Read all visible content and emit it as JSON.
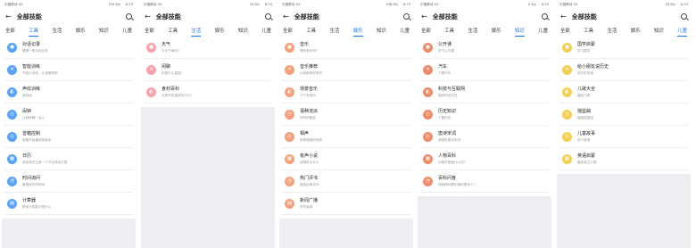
{
  "screens": [
    {
      "status": {
        "carrier": "中国移动 4G",
        "speed": "199 B/s",
        "time": "8:29"
      },
      "title": "全部技能",
      "tabs": [
        "全部",
        "工具",
        "生活",
        "娱乐",
        "知识",
        "儿童"
      ],
      "active_tab": 1,
      "items": [
        {
          "title": "对话记录",
          "subtitle": "看看一条对话记录",
          "color": "#5aa2f5",
          "icon": "chat-icon"
        },
        {
          "title": "智能训练",
          "subtitle": "不如小训练，让我更聪明",
          "color": "#5aa2f5",
          "icon": "tools-icon"
        },
        {
          "title": "声纹训练",
          "subtitle": "我说话",
          "color": "#5aa2f5",
          "icon": "voiceprint-icon"
        },
        {
          "title": "闹钟",
          "subtitle": "让我再睡一会儿",
          "color": "#5aa2f5",
          "icon": "alarm-icon"
        },
        {
          "title": "音箱控制",
          "subtitle": "音箱开始播放新版本",
          "color": "#5aa2f5",
          "icon": "speaker-icon"
        },
        {
          "title": "日历",
          "subtitle": "添加和关注某一个节日或者日程",
          "color": "#5aa2f5",
          "icon": "calendar-icon"
        },
        {
          "title": "时间询问",
          "subtitle": "看看现在的时间",
          "color": "#5aa2f5",
          "icon": "clock-icon"
        },
        {
          "title": "计算器",
          "subtitle": "帮你计算数字是什么",
          "color": "#5aa2f5",
          "icon": "calculator-icon"
        }
      ]
    },
    {
      "status": {
        "carrier": "中国移动 4G",
        "speed": "26 B/s",
        "time": "8:29"
      },
      "title": "全部技能",
      "tabs": [
        "全部",
        "工具",
        "生活",
        "娱乐",
        "知识",
        "儿童"
      ],
      "active_tab": 2,
      "items": [
        {
          "title": "天气",
          "subtitle": "今天下雨吗？",
          "color": "#f7a3ab",
          "icon": "cloud-icon"
        },
        {
          "title": "闲聊",
          "subtitle": "你是什么星座？",
          "color": "#f7a3ab",
          "icon": "chat-bubble-icon"
        },
        {
          "title": "食材百科",
          "subtitle": "总是不知道该吃什么？",
          "color": "#f7a3ab",
          "icon": "food-icon"
        }
      ]
    },
    {
      "status": {
        "carrier": "中国移动 4G",
        "speed": "298 B/s",
        "time": "8:29"
      },
      "title": "全部技能",
      "tabs": [
        "全部",
        "工具",
        "生活",
        "娱乐",
        "知识",
        "儿童"
      ],
      "active_tab": 3,
      "items": [
        {
          "title": "音乐",
          "subtitle": "想听音乐吗？",
          "color": "#f4a07b",
          "icon": "music-icon"
        },
        {
          "title": "音乐推荐",
          "subtitle": "为你推荐好听的",
          "color": "#f4a07b",
          "icon": "music-note-icon"
        },
        {
          "title": "场景音乐",
          "subtitle": "下午茶音乐",
          "color": "#f4a07b",
          "icon": "scene-music-icon"
        },
        {
          "title": "语种流派",
          "subtitle": "好听的歌曲",
          "color": "#f4a07b",
          "icon": "genre-icon"
        },
        {
          "title": "相声",
          "subtitle": "听郭德纲的相声",
          "color": "#f4a07b",
          "icon": "crosstalk-icon"
        },
        {
          "title": "有声小说",
          "subtitle": "我想听点什么",
          "color": "#f4a07b",
          "icon": "audiobook-icon"
        },
        {
          "title": "热门评书",
          "subtitle": "播放经典评书",
          "color": "#f4a07b",
          "icon": "storytelling-icon"
        },
        {
          "title": "新闻广播",
          "subtitle": "好的新闻",
          "color": "#f4a07b",
          "icon": "radio-icon"
        }
      ]
    },
    {
      "status": {
        "carrier": "中国移动 4G",
        "speed": "0 K/s",
        "time": "8:29"
      },
      "title": "全部技能",
      "tabs": [
        "全部",
        "工具",
        "生活",
        "娱乐",
        "知识",
        "儿童"
      ],
      "active_tab": 4,
      "items": [
        {
          "title": "公开课",
          "subtitle": "学习公开课",
          "color": "#ef8a6a",
          "icon": "class-icon"
        },
        {
          "title": "汽车",
          "subtitle": "了解汽车",
          "color": "#ef8a6a",
          "icon": "car-icon"
        },
        {
          "title": "科技与互联网",
          "subtitle": "播放科技节目",
          "color": "#ef8a6a",
          "icon": "tech-icon"
        },
        {
          "title": "历史知识",
          "subtitle": "了解历史",
          "color": "#ef8a6a",
          "icon": "history-icon"
        },
        {
          "title": "唐诗宋词",
          "subtitle": "我想听唐诗宋词",
          "color": "#ef8a6a",
          "icon": "poetry-icon"
        },
        {
          "title": "人物百科",
          "subtitle": "刘德华是做什么的？",
          "color": "#ef8a6a",
          "icon": "person-icon"
        },
        {
          "title": "百科问答",
          "subtitle": "珠穆朗玛峰的海拔是多少？",
          "color": "#ef8a6a",
          "icon": "encyclopedia-icon"
        }
      ]
    },
    {
      "status": {
        "carrier": "中国移动 4G",
        "speed": "26 B/s",
        "time": "8:29"
      },
      "title": "全部技能",
      "tabs": [
        "全部",
        "工具",
        "生活",
        "娱乐",
        "知识",
        "儿童"
      ],
      "active_tab": 5,
      "items": [
        {
          "title": "国学启蒙",
          "subtitle": "学习国学",
          "color": "#f3cf56",
          "icon": "book-icon"
        },
        {
          "title": "给小朋友说历史",
          "subtitle": "讲历史故事",
          "color": "#f3cf56",
          "icon": "history-kids-icon"
        },
        {
          "title": "儿歌大全",
          "subtitle": "播放儿歌",
          "color": "#f3cf56",
          "icon": "kids-song-icon"
        },
        {
          "title": "摇篮曲",
          "subtitle": "播放摇篮曲",
          "color": "#f3cf56",
          "icon": "lullaby-icon"
        },
        {
          "title": "儿童故事",
          "subtitle": "讲个故事",
          "color": "#f3cf56",
          "icon": "story-icon"
        },
        {
          "title": "英语启蒙",
          "subtitle": "播放英文儿歌",
          "color": "#f3cf56",
          "icon": "english-icon"
        }
      ]
    }
  ]
}
